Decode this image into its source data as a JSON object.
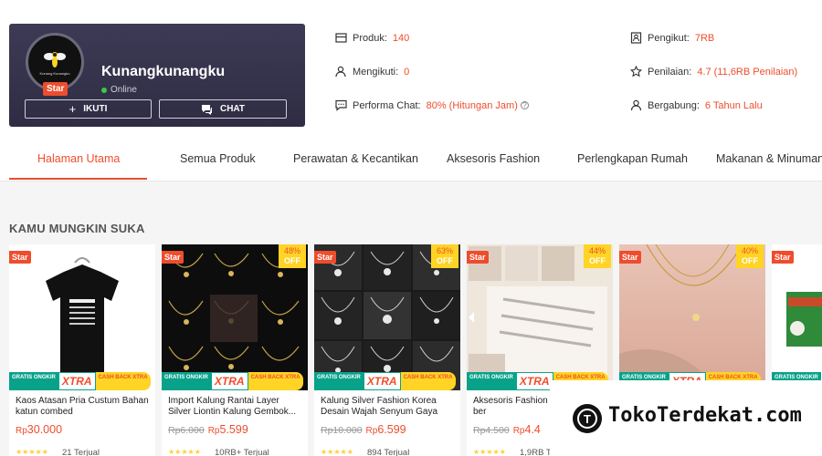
{
  "shop": {
    "name": "Kunangkunangku",
    "status": "Online",
    "badge": "Star",
    "avatar_text": "Kunang Kunangku",
    "follow_label": "IKUTI",
    "chat_label": "CHAT"
  },
  "stats": {
    "produk_label": "Produk:",
    "produk_value": "140",
    "mengikuti_label": "Mengikuti:",
    "mengikuti_value": "0",
    "performa_label": "Performa Chat:",
    "performa_value": "80% (Hitungan Jam)",
    "pengikut_label": "Pengikut:",
    "pengikut_value": "7RB",
    "penilaian_label": "Penilaian:",
    "penilaian_value": "4.7 (11,6RB Penilaian)",
    "bergabung_label": "Bergabung:",
    "bergabung_value": "6 Tahun Lalu"
  },
  "tabs": [
    "Halaman Utama",
    "Semua Produk",
    "Perawatan & Kecantikan",
    "Aksesoris Fashion",
    "Perlengkapan Rumah",
    "Makanan & Minuman"
  ],
  "section_title": "KAMU MUNGKIN SUKA",
  "promo": {
    "gratis": "GRATIS ONGKIR",
    "xtra": "XTRA",
    "cashback": "CASH BACK XTRA"
  },
  "products": [
    {
      "star": "Star",
      "discount": "",
      "off": "",
      "name": "Kaos Atasan Pria Custum Bahan katun combed",
      "old_price": "",
      "price_rp": "Rp",
      "price": "30.000",
      "stars": "★★★★★",
      "sold": "21 Terjual"
    },
    {
      "star": "Star",
      "discount": "48%",
      "off": "OFF",
      "name": "Import Kalung Rantai Layer Silver Liontin Kalung Gembok...",
      "old_price": "Rp6.000",
      "price_rp": "Rp",
      "price": "5.599",
      "stars": "★★★★★",
      "sold": "10RB+ Terjual"
    },
    {
      "star": "Star",
      "discount": "63%",
      "off": "OFF",
      "name": "Kalung Silver Fashion Korea Desain Wajah Senyum Gaya hip...",
      "old_price": "Rp10.000",
      "price_rp": "Rp",
      "price": "6.599",
      "stars": "★★★★★",
      "sold": "894 Terjual"
    },
    {
      "star": "Star",
      "discount": "44%",
      "off": "OFF",
      "name": "Aksesoris Fashion Tangan Serut ber",
      "old_price": "Rp4.500",
      "price_rp": "Rp",
      "price": "4.4",
      "stars": "★★★★★",
      "sold": "1,9RB Ter"
    },
    {
      "star": "Star",
      "discount": "40%",
      "off": "OFF",
      "name": "",
      "old_price": "",
      "price_rp": "",
      "price": "",
      "stars": "",
      "sold": ""
    },
    {
      "star": "Star",
      "discount": "",
      "off": "",
      "name": "",
      "old_price": "",
      "price_rp": "",
      "price": "",
      "stars": "",
      "sold": ""
    }
  ],
  "watermark": {
    "logo_letter": "T",
    "text": "TokoTerdekat.com"
  },
  "colors": {
    "accent": "#ee4d2d",
    "shopcard": "#34314a",
    "promo_green": "#08a28a",
    "promo_yellow": "#ffd424"
  }
}
